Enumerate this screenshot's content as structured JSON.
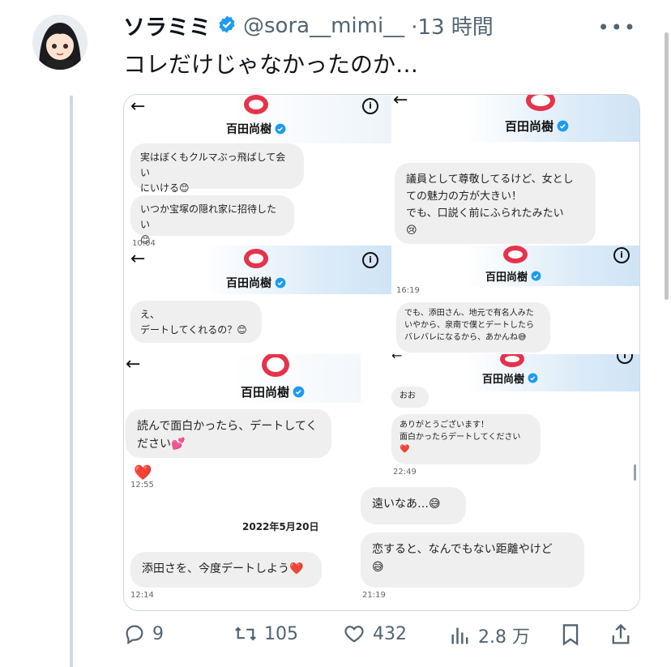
{
  "tweet": {
    "display_name": "ソラミミ",
    "handle": "@sora__mimi__",
    "time": "·13 時間",
    "text": "コレだけじゃなかったのか…",
    "more": "•••"
  },
  "media": {
    "contact_name": "百田尚樹",
    "panel1": {
      "msg1": "実はぼくもクルマぶっ飛ばして会い\nにいける😊",
      "msg2": "いつか宝塚の隠れ家に招待したい\n😊",
      "time": "10:04"
    },
    "panel2": {
      "msg1": "議員として尊敬してるけど、女とし\nての魅力の方が大きい！\nでも、口説く前にふられたみたい\n😢"
    },
    "panel3": {
      "msg1": "え、\nデートしてくれるの？😊"
    },
    "panel4": {
      "time": "16:19",
      "msg1": "でも、添田さん、地元で有名人みた\nいやから、泉南で僕とデートしたら\nバレバレになるから、あかんね😅"
    },
    "panel5": {
      "msg1": "読んで面白かったら、デートしてく\nださい💕",
      "reaction": "❤️",
      "time1": "12:55",
      "date": "2022年5月20日",
      "msg2": "添田さを、今度デートしよう❤️",
      "time2": "12:14"
    },
    "panel6": {
      "msg0": "おお",
      "msg1": "ありがとうございます！\n面白かったらデートしてください\n❤️",
      "time1": "22:49",
      "msg2": "遠いなあ…😅",
      "msg3": "恋すると、なんでもない距離やけど\n😅",
      "time2": "21:19"
    }
  },
  "actions": {
    "replies": "9",
    "retweets": "105",
    "likes": "432",
    "views": "2.8 万"
  },
  "colors": {
    "verified": "#1d9bf0",
    "ring": "#e5334b",
    "muted": "#536471"
  }
}
